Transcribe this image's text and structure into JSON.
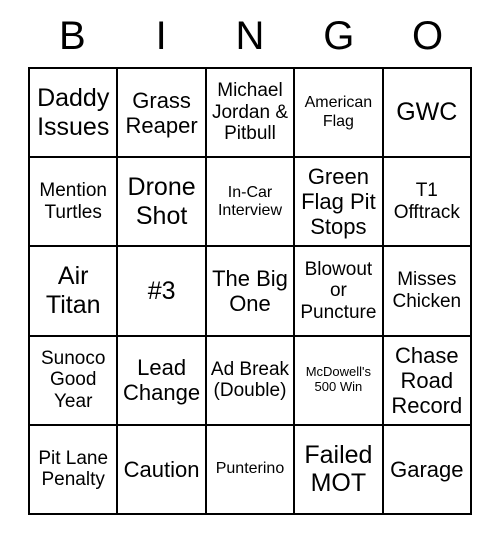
{
  "card": {
    "title": "BINGO",
    "columns": 5,
    "rows": 5,
    "background_color": "#ffffff",
    "border_color": "#000000",
    "text_color": "#000000"
  },
  "header": {
    "letters": [
      "B",
      "I",
      "N",
      "G",
      "O"
    ]
  },
  "grid": {
    "rows": [
      [
        {
          "text": "Daddy Issues",
          "size": "fs-xl"
        },
        {
          "text": "Grass Reaper",
          "size": "fs-lg"
        },
        {
          "text": "Michael Jordan & Pitbull",
          "size": "fs-md"
        },
        {
          "text": "American Flag",
          "size": "fs-sm"
        },
        {
          "text": "GWC",
          "size": "fs-xl"
        }
      ],
      [
        {
          "text": "Mention Turtles",
          "size": "fs-md"
        },
        {
          "text": "Drone Shot",
          "size": "fs-xl"
        },
        {
          "text": "In-Car Interview",
          "size": "fs-sm"
        },
        {
          "text": "Green Flag Pit Stops",
          "size": "fs-lg"
        },
        {
          "text": "T1 Offtrack",
          "size": "fs-md"
        }
      ],
      [
        {
          "text": "Air Titan",
          "size": "fs-xl"
        },
        {
          "text": "#3",
          "size": "fs-xl"
        },
        {
          "text": "The Big One",
          "size": "fs-lg"
        },
        {
          "text": "Blowout or Puncture",
          "size": "fs-md"
        },
        {
          "text": "Misses Chicken",
          "size": "fs-md"
        }
      ],
      [
        {
          "text": "Sunoco Good Year",
          "size": "fs-md"
        },
        {
          "text": "Lead Change",
          "size": "fs-lg"
        },
        {
          "text": "Ad Break (Double)",
          "size": "fs-md"
        },
        {
          "text": "McDowell's 500 Win",
          "size": "fs-xs"
        },
        {
          "text": "Chase Road Record",
          "size": "fs-lg"
        }
      ],
      [
        {
          "text": "Pit Lane Penalty",
          "size": "fs-md"
        },
        {
          "text": "Caution",
          "size": "fs-lg"
        },
        {
          "text": "Punterino",
          "size": "fs-sm"
        },
        {
          "text": "Failed MOT",
          "size": "fs-xl"
        },
        {
          "text": "Garage",
          "size": "fs-lg"
        }
      ]
    ]
  }
}
